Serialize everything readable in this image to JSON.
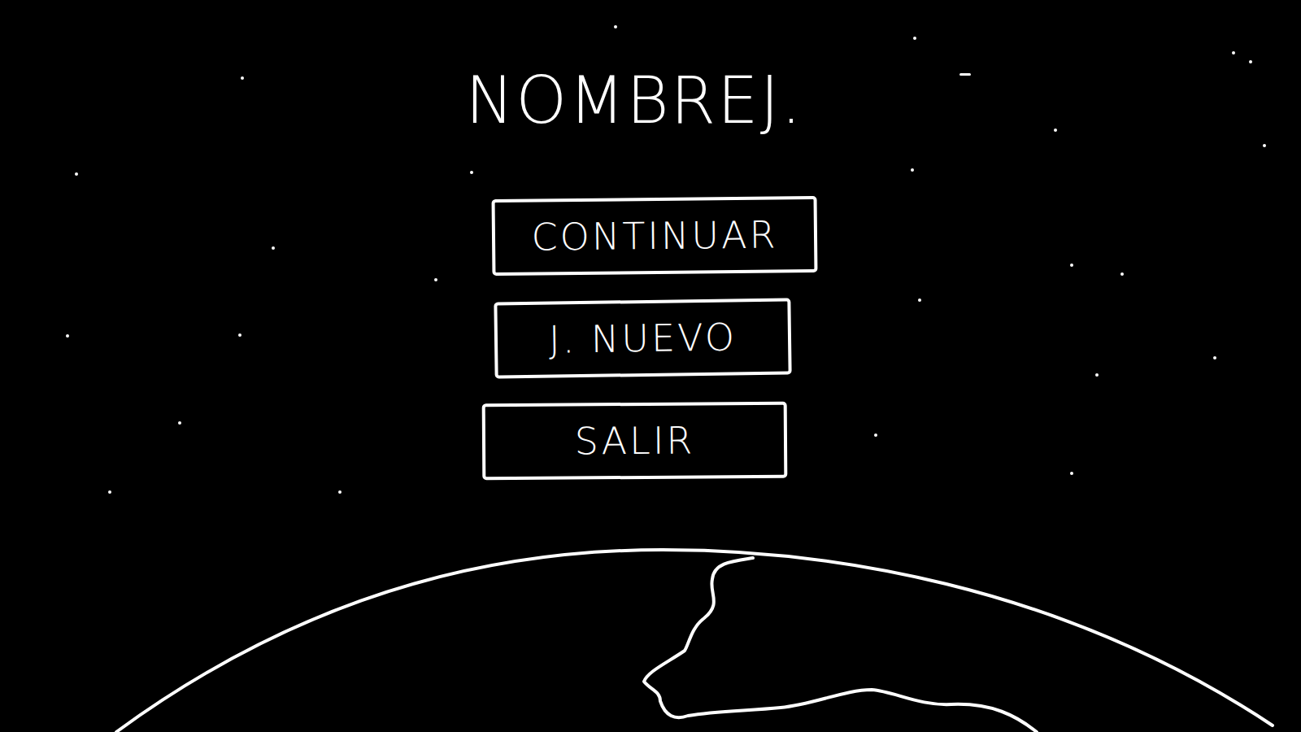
{
  "title": "NOMBREJ.",
  "menu": {
    "buttons": [
      {
        "label": "CONTINUAR"
      },
      {
        "label": "J. NUEVO"
      },
      {
        "label": "SALIR"
      }
    ]
  }
}
